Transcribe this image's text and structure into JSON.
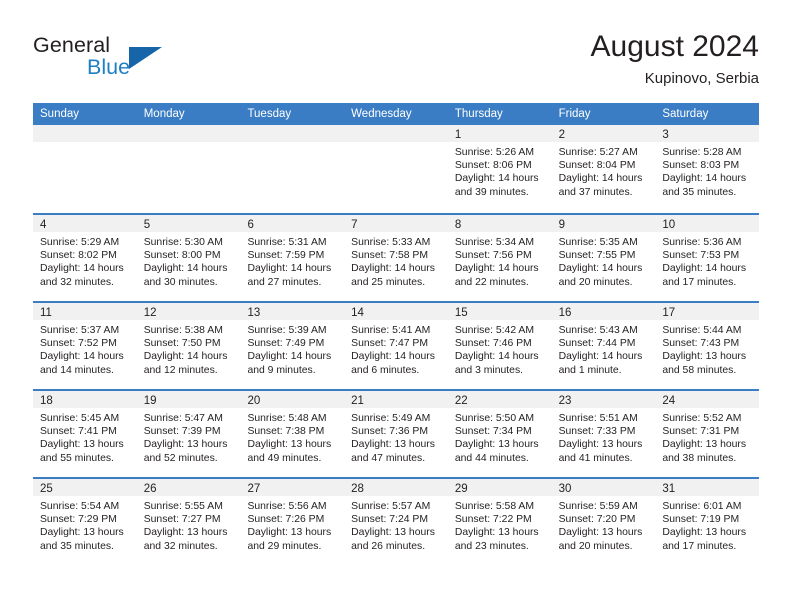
{
  "brand": {
    "name_top": "General",
    "name_bottom": "Blue",
    "colors": {
      "blue": "#1f7fc4",
      "triangle": "#1565a8",
      "header_blue": "#3a7dc4",
      "band_gray": "#f1f1f1"
    }
  },
  "header": {
    "title": "August 2024",
    "subtitle": "Kupinovo, Serbia"
  },
  "calendar": {
    "weekdays": [
      "Sunday",
      "Monday",
      "Tuesday",
      "Wednesday",
      "Thursday",
      "Friday",
      "Saturday"
    ],
    "weeks": [
      [
        {
          "day": "",
          "lines": []
        },
        {
          "day": "",
          "lines": []
        },
        {
          "day": "",
          "lines": []
        },
        {
          "day": "",
          "lines": []
        },
        {
          "day": "1",
          "lines": [
            "Sunrise: 5:26 AM",
            "Sunset: 8:06 PM",
            "Daylight: 14 hours",
            "and 39 minutes."
          ]
        },
        {
          "day": "2",
          "lines": [
            "Sunrise: 5:27 AM",
            "Sunset: 8:04 PM",
            "Daylight: 14 hours",
            "and 37 minutes."
          ]
        },
        {
          "day": "3",
          "lines": [
            "Sunrise: 5:28 AM",
            "Sunset: 8:03 PM",
            "Daylight: 14 hours",
            "and 35 minutes."
          ]
        }
      ],
      [
        {
          "day": "4",
          "lines": [
            "Sunrise: 5:29 AM",
            "Sunset: 8:02 PM",
            "Daylight: 14 hours",
            "and 32 minutes."
          ]
        },
        {
          "day": "5",
          "lines": [
            "Sunrise: 5:30 AM",
            "Sunset: 8:00 PM",
            "Daylight: 14 hours",
            "and 30 minutes."
          ]
        },
        {
          "day": "6",
          "lines": [
            "Sunrise: 5:31 AM",
            "Sunset: 7:59 PM",
            "Daylight: 14 hours",
            "and 27 minutes."
          ]
        },
        {
          "day": "7",
          "lines": [
            "Sunrise: 5:33 AM",
            "Sunset: 7:58 PM",
            "Daylight: 14 hours",
            "and 25 minutes."
          ]
        },
        {
          "day": "8",
          "lines": [
            "Sunrise: 5:34 AM",
            "Sunset: 7:56 PM",
            "Daylight: 14 hours",
            "and 22 minutes."
          ]
        },
        {
          "day": "9",
          "lines": [
            "Sunrise: 5:35 AM",
            "Sunset: 7:55 PM",
            "Daylight: 14 hours",
            "and 20 minutes."
          ]
        },
        {
          "day": "10",
          "lines": [
            "Sunrise: 5:36 AM",
            "Sunset: 7:53 PM",
            "Daylight: 14 hours",
            "and 17 minutes."
          ]
        }
      ],
      [
        {
          "day": "11",
          "lines": [
            "Sunrise: 5:37 AM",
            "Sunset: 7:52 PM",
            "Daylight: 14 hours",
            "and 14 minutes."
          ]
        },
        {
          "day": "12",
          "lines": [
            "Sunrise: 5:38 AM",
            "Sunset: 7:50 PM",
            "Daylight: 14 hours",
            "and 12 minutes."
          ]
        },
        {
          "day": "13",
          "lines": [
            "Sunrise: 5:39 AM",
            "Sunset: 7:49 PM",
            "Daylight: 14 hours",
            "and 9 minutes."
          ]
        },
        {
          "day": "14",
          "lines": [
            "Sunrise: 5:41 AM",
            "Sunset: 7:47 PM",
            "Daylight: 14 hours",
            "and 6 minutes."
          ]
        },
        {
          "day": "15",
          "lines": [
            "Sunrise: 5:42 AM",
            "Sunset: 7:46 PM",
            "Daylight: 14 hours",
            "and 3 minutes."
          ]
        },
        {
          "day": "16",
          "lines": [
            "Sunrise: 5:43 AM",
            "Sunset: 7:44 PM",
            "Daylight: 14 hours",
            "and 1 minute."
          ]
        },
        {
          "day": "17",
          "lines": [
            "Sunrise: 5:44 AM",
            "Sunset: 7:43 PM",
            "Daylight: 13 hours",
            "and 58 minutes."
          ]
        }
      ],
      [
        {
          "day": "18",
          "lines": [
            "Sunrise: 5:45 AM",
            "Sunset: 7:41 PM",
            "Daylight: 13 hours",
            "and 55 minutes."
          ]
        },
        {
          "day": "19",
          "lines": [
            "Sunrise: 5:47 AM",
            "Sunset: 7:39 PM",
            "Daylight: 13 hours",
            "and 52 minutes."
          ]
        },
        {
          "day": "20",
          "lines": [
            "Sunrise: 5:48 AM",
            "Sunset: 7:38 PM",
            "Daylight: 13 hours",
            "and 49 minutes."
          ]
        },
        {
          "day": "21",
          "lines": [
            "Sunrise: 5:49 AM",
            "Sunset: 7:36 PM",
            "Daylight: 13 hours",
            "and 47 minutes."
          ]
        },
        {
          "day": "22",
          "lines": [
            "Sunrise: 5:50 AM",
            "Sunset: 7:34 PM",
            "Daylight: 13 hours",
            "and 44 minutes."
          ]
        },
        {
          "day": "23",
          "lines": [
            "Sunrise: 5:51 AM",
            "Sunset: 7:33 PM",
            "Daylight: 13 hours",
            "and 41 minutes."
          ]
        },
        {
          "day": "24",
          "lines": [
            "Sunrise: 5:52 AM",
            "Sunset: 7:31 PM",
            "Daylight: 13 hours",
            "and 38 minutes."
          ]
        }
      ],
      [
        {
          "day": "25",
          "lines": [
            "Sunrise: 5:54 AM",
            "Sunset: 7:29 PM",
            "Daylight: 13 hours",
            "and 35 minutes."
          ]
        },
        {
          "day": "26",
          "lines": [
            "Sunrise: 5:55 AM",
            "Sunset: 7:27 PM",
            "Daylight: 13 hours",
            "and 32 minutes."
          ]
        },
        {
          "day": "27",
          "lines": [
            "Sunrise: 5:56 AM",
            "Sunset: 7:26 PM",
            "Daylight: 13 hours",
            "and 29 minutes."
          ]
        },
        {
          "day": "28",
          "lines": [
            "Sunrise: 5:57 AM",
            "Sunset: 7:24 PM",
            "Daylight: 13 hours",
            "and 26 minutes."
          ]
        },
        {
          "day": "29",
          "lines": [
            "Sunrise: 5:58 AM",
            "Sunset: 7:22 PM",
            "Daylight: 13 hours",
            "and 23 minutes."
          ]
        },
        {
          "day": "30",
          "lines": [
            "Sunrise: 5:59 AM",
            "Sunset: 7:20 PM",
            "Daylight: 13 hours",
            "and 20 minutes."
          ]
        },
        {
          "day": "31",
          "lines": [
            "Sunrise: 6:01 AM",
            "Sunset: 7:19 PM",
            "Daylight: 13 hours",
            "and 17 minutes."
          ]
        }
      ]
    ]
  }
}
